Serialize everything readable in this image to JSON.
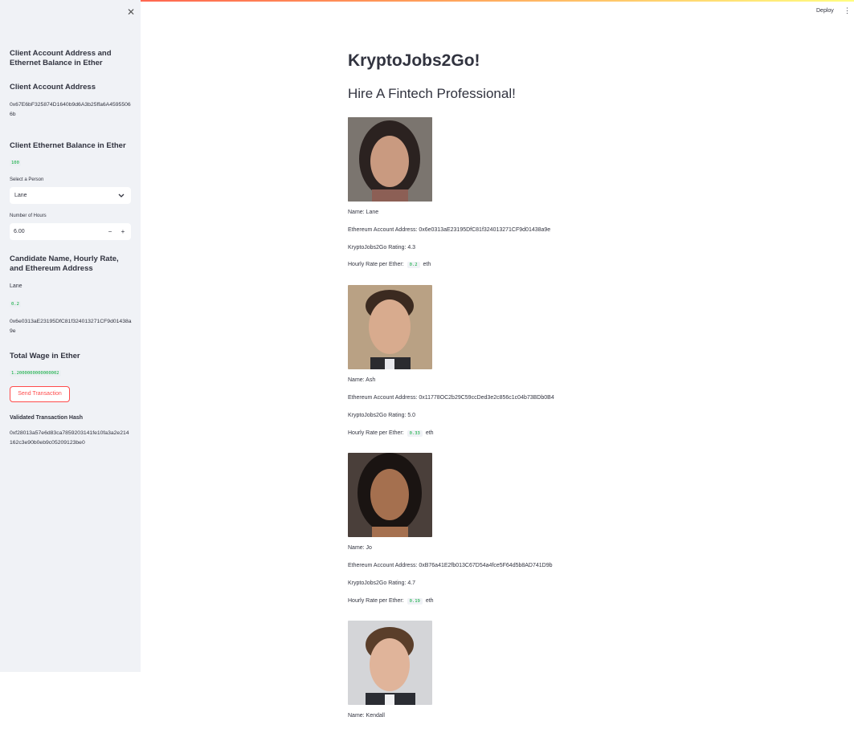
{
  "header": {
    "deploy_label": "Deploy",
    "menu_icon": "kebab-menu-icon",
    "gradient_colors": [
      "#ff4b4b",
      "#ff9f5a",
      "#fffd80"
    ]
  },
  "sidebar": {
    "close_icon": "close-icon",
    "section_title": "Client Account Address and Ethernet Balance in Ether",
    "account_address_title": "Client Account Address",
    "account_address": "0x67E6bF325874D1640b9d6A3b25ffa6A45955066b",
    "balance_title": "Client Ethernet Balance in Ether",
    "balance_value": "100",
    "select_person_label": "Select a Person",
    "selected_person": "Lane",
    "hours_label": "Number of Hours",
    "hours_value": "6.00",
    "candidate_title": "Candidate Name, Hourly Rate, and Ethereum Address",
    "candidate_name": "Lane",
    "candidate_rate": "0.2",
    "candidate_address": "0x6e0313aE23195DfC81f324013271CF9d01438a9e",
    "wage_title": "Total Wage in Ether",
    "wage_value": "1.2000000000000002",
    "send_button": "Send Transaction",
    "hash_title": "Validated Transaction Hash",
    "hash_value": "0xf28013a57e6d83ca7859203141fe10fa3a2e214162c3e90b0eb9c05209123be0"
  },
  "main": {
    "title": "KryptoJobs2Go!",
    "subtitle": "Hire A Fintech Professional!",
    "candidates": [
      {
        "name": "Name: Lane",
        "address": "Ethereum Account Address: 0x6e0313aE23195DfC81f324013271CF9d01438a9e",
        "rating": "KryptoJobs2Go Rating: 4.3",
        "rate_label": "Hourly Rate per Ether:",
        "rate": "0.2",
        "rate_unit": "eth"
      },
      {
        "name": "Name: Ash",
        "address": "Ethereum Account Address: 0x11778OC2b29C59ccDed3e2c856c1c04b73BDb0B4",
        "rating": "KryptoJobs2Go Rating: 5.0",
        "rate_label": "Hourly Rate per Ether:",
        "rate": "0.33",
        "rate_unit": "eth"
      },
      {
        "name": "Name: Jo",
        "address": "Ethereum Account Address: 0xB76a41E2fb013C67D54a4fce5F64d5b8AD741D9b",
        "rating": "KryptoJobs2Go Rating: 4.7",
        "rate_label": "Hourly Rate per Ether:",
        "rate": "0.19",
        "rate_unit": "eth"
      },
      {
        "name": "Name: Kendall"
      }
    ]
  }
}
